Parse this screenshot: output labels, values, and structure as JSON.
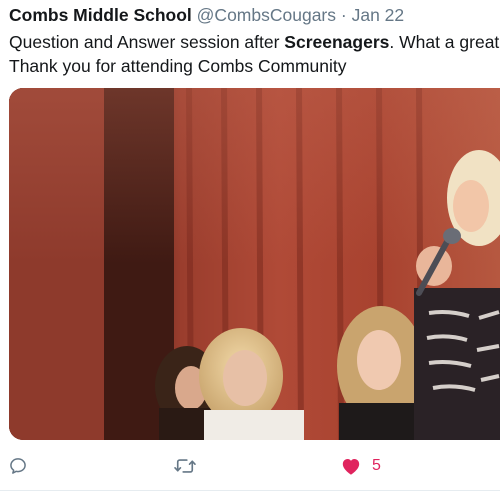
{
  "tweet": {
    "author_name": "Combs Middle School",
    "author_handle": "@CombsCougars",
    "separator": "·",
    "date": "Jan 22",
    "text_line1_prefix": "Question and Answer session after ",
    "text_line1_bold": "Screenagers",
    "text_line1_suffix": ". What a great night!",
    "text_line2": "Thank you for attending Combs Community",
    "media": {
      "kind": "photo",
      "subject": "stage-with-red-curtain-and-speakers"
    },
    "actions": {
      "reply_icon": "reply-icon",
      "retweet_icon": "retweet-icon",
      "like_icon": "heart-icon",
      "like_count": "5",
      "like_color": "#e0245e",
      "icon_color": "#657786"
    }
  }
}
